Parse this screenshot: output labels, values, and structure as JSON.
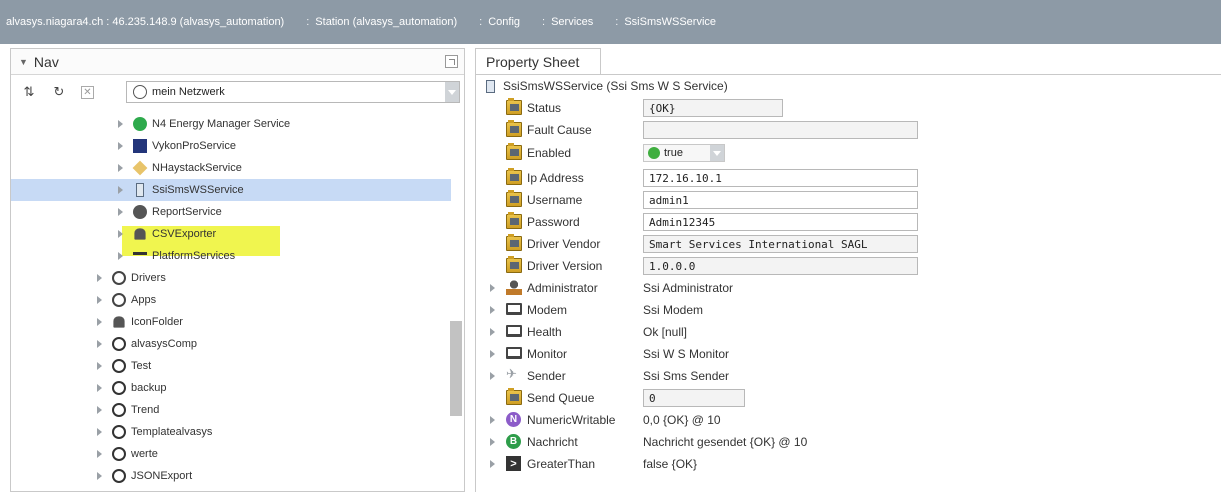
{
  "pathbar": {
    "segments": [
      "alvasys.niagara4.ch : 46.235.148.9 (alvasys_automation)",
      "Station (alvasys_automation)",
      "Config",
      "Services",
      "SsiSmsWSService"
    ]
  },
  "nav": {
    "title": "Nav",
    "network_select": "mein Netzwerk",
    "tree": [
      {
        "label": "N4 Energy Manager Service",
        "icon": "energy-icon"
      },
      {
        "label": "VykonProService",
        "icon": "vykon-icon"
      },
      {
        "label": "NHaystackService",
        "icon": "tag-icon"
      },
      {
        "label": "SsiSmsWSService",
        "icon": "phone-icon",
        "selected": true
      },
      {
        "label": "ReportService",
        "icon": "report-icon"
      },
      {
        "label": "CSVExporter",
        "icon": "bell-icon"
      },
      {
        "label": "PlatformServices",
        "icon": "platform-icon"
      },
      {
        "label": "Drivers",
        "icon": "drivers-icon"
      },
      {
        "label": "Apps",
        "icon": "apps-icon"
      },
      {
        "label": "IconFolder",
        "icon": "bell-icon"
      },
      {
        "label": "alvasysComp",
        "icon": "folder-circle-icon"
      },
      {
        "label": "Test",
        "icon": "folder-circle-icon"
      },
      {
        "label": "backup",
        "icon": "folder-circle-icon"
      },
      {
        "label": "Trend",
        "icon": "folder-circle-icon"
      },
      {
        "label": "Templatealvasys",
        "icon": "folder-circle-icon"
      },
      {
        "label": "werte",
        "icon": "folder-circle-icon"
      },
      {
        "label": "JSONExport",
        "icon": "folder-circle-icon"
      }
    ]
  },
  "property_sheet": {
    "tab": "Property Sheet",
    "root": "SsiSmsWSService  (Ssi Sms W S Service)",
    "rows": [
      {
        "label": "Status",
        "value": "{OK}"
      },
      {
        "label": "Fault Cause",
        "value": ""
      },
      {
        "label": "Enabled",
        "value": "true"
      },
      {
        "label": "Ip Address",
        "value": "172.16.10.1"
      },
      {
        "label": "Username",
        "value": "admin1"
      },
      {
        "label": "Password",
        "value": "Admin12345"
      },
      {
        "label": "Driver Vendor",
        "value": "Smart Services International SAGL"
      },
      {
        "label": "Driver Version",
        "value": "1.0.0.0"
      },
      {
        "label": "Administrator",
        "value": "Ssi Administrator"
      },
      {
        "label": "Modem",
        "value": "Ssi Modem"
      },
      {
        "label": "Health",
        "value": "Ok [null]"
      },
      {
        "label": "Monitor",
        "value": "Ssi W S Monitor"
      },
      {
        "label": "Sender",
        "value": "Ssi Sms Sender"
      },
      {
        "label": "Send Queue",
        "value": "0"
      },
      {
        "label": "NumericWritable",
        "value": "0,0 {OK} @ 10"
      },
      {
        "label": "Nachricht",
        "value": "Nachricht gesendet {OK} @ 10"
      },
      {
        "label": "GreaterThan",
        "value": "false {OK}"
      }
    ]
  },
  "colors": {
    "pathbar": "#8d9aa6",
    "selection": "#c7daf5",
    "highlight": "#ebf214"
  }
}
